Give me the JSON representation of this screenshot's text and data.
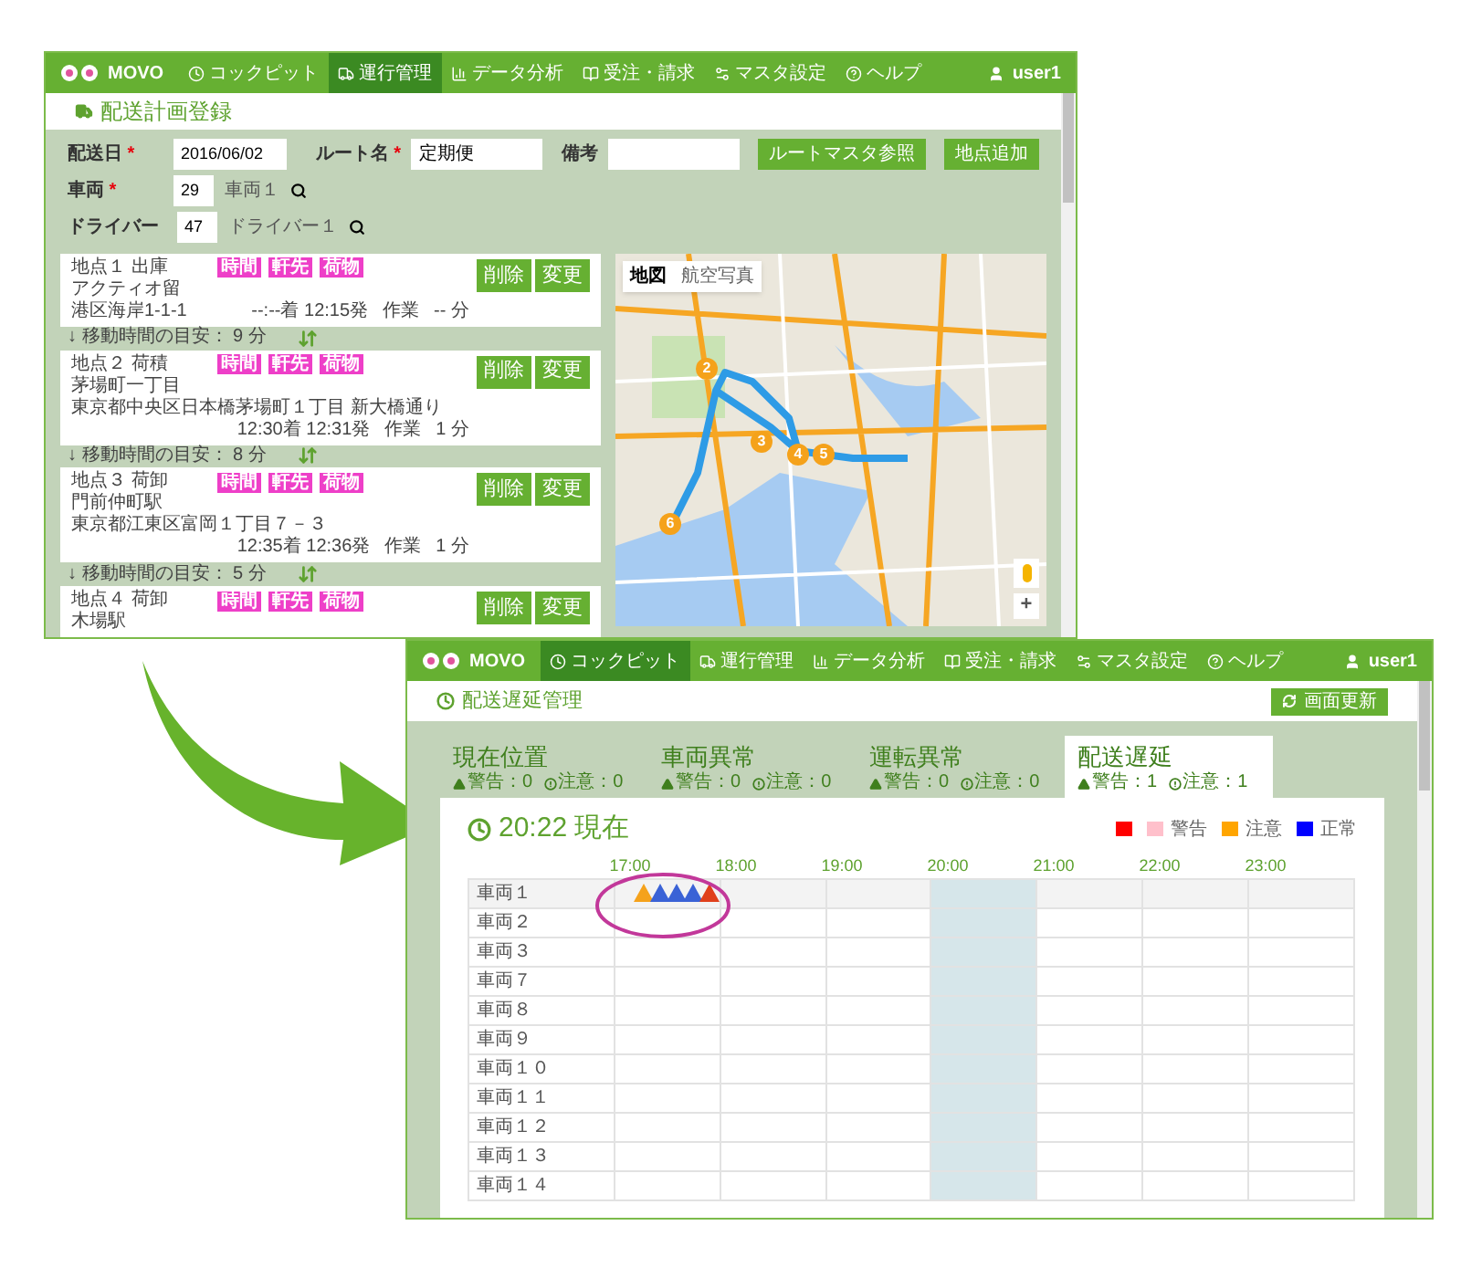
{
  "planning_window": {
    "nav": {
      "brand": "MOVO",
      "user": "user1",
      "items": [
        {
          "label": "コックピット",
          "selected": false
        },
        {
          "label": "運行管理",
          "selected": true
        },
        {
          "label": "データ分析",
          "selected": false
        },
        {
          "label": "受注・請求",
          "selected": false
        },
        {
          "label": "マスタ設定",
          "selected": false
        },
        {
          "label": "ヘルプ",
          "selected": false
        }
      ]
    },
    "page_title": "配送計画登録",
    "required_mark": "*",
    "form": {
      "date": {
        "label": "配送日",
        "required": true,
        "value": "2016/06/02"
      },
      "route": {
        "label": "ルート名",
        "required": true,
        "value": "定期便"
      },
      "note": {
        "label": "備考",
        "required": false
      },
      "buttons": [
        "ルートマスタ参照",
        "地点追加"
      ],
      "vehicle": {
        "label": "車両",
        "required": true,
        "value": "29",
        "name": "車両１"
      },
      "driver": {
        "label": "ドライバー",
        "required": false,
        "value": "47",
        "name": "ドライバー１"
      }
    },
    "stops": [
      {
        "title": "地点１ 出庫",
        "tags": [
          "時間",
          "軒先",
          "荷物"
        ],
        "name": "アクティオ留",
        "address": "港区海岸1-1-1",
        "times": "--:--着 12:15発",
        "work_label": "作業",
        "work": "-- 分",
        "actions": [
          "削除",
          "変更"
        ],
        "travel": "↓ 移動時間の目安： 9 分"
      },
      {
        "title": "地点２ 荷積",
        "tags": [
          "時間",
          "軒先",
          "荷物"
        ],
        "name": "茅場町一丁目",
        "address": "東京都中央区日本橋茅場町１丁目 新大橋通り",
        "times": "12:30着 12:31発",
        "work_label": "作業",
        "work": "1 分",
        "actions": [
          "削除",
          "変更"
        ],
        "travel": "↓ 移動時間の目安： 8 分"
      },
      {
        "title": "地点３ 荷卸",
        "tags": [
          "時間",
          "軒先",
          "荷物"
        ],
        "name": "門前仲町駅",
        "address": "東京都江東区富岡１丁目７－３",
        "times": "12:35着 12:36発",
        "work_label": "作業",
        "work": "1 分",
        "actions": [
          "削除",
          "変更"
        ],
        "travel": "↓ 移動時間の目安： 5 分"
      },
      {
        "title": "地点４ 荷卸",
        "tags": [
          "時間",
          "軒先",
          "荷物"
        ],
        "name": "木場駅",
        "actions": [
          "削除",
          "変更"
        ]
      }
    ],
    "map": {
      "types": [
        {
          "label": "地図",
          "selected": true
        },
        {
          "label": "航空写真",
          "selected": false
        }
      ],
      "markers": [
        {
          "label": "2"
        },
        {
          "label": "3"
        },
        {
          "label": "4"
        },
        {
          "label": "5"
        },
        {
          "label": "6"
        }
      ],
      "zoom_in": "+"
    }
  },
  "delay_window": {
    "nav": {
      "brand": "MOVO",
      "user": "user1",
      "items": [
        {
          "label": "コックピット",
          "selected": true
        },
        {
          "label": "運行管理",
          "selected": false
        },
        {
          "label": "データ分析",
          "selected": false
        },
        {
          "label": "受注・請求",
          "selected": false
        },
        {
          "label": "マスタ設定",
          "selected": false
        },
        {
          "label": "ヘルプ",
          "selected": false
        }
      ]
    },
    "page_title": "配送遅延管理",
    "refresh_button": "画面更新",
    "tabs": [
      {
        "title": "現在位置",
        "warning": "警告：0",
        "caution": "注意：0",
        "selected": false
      },
      {
        "title": "車両異常",
        "warning": "警告：0",
        "caution": "注意：0",
        "selected": false
      },
      {
        "title": "運転異常",
        "warning": "警告：0",
        "caution": "注意：0",
        "selected": false
      },
      {
        "title": "配送遅延",
        "warning": "警告：1",
        "caution": "注意：1",
        "selected": true
      }
    ],
    "current_time": "20:22 現在",
    "legend": [
      {
        "color": "#ff0000"
      },
      {
        "color": "#ffc0cb",
        "label": "警告"
      },
      {
        "color": "#ffa500",
        "label": "注意"
      },
      {
        "color": "#0000ff",
        "label": "正常"
      }
    ],
    "hours": [
      {
        "label": "17:00",
        "current": false
      },
      {
        "label": "18:00",
        "current": false
      },
      {
        "label": "19:00",
        "current": false
      },
      {
        "label": "20:00",
        "current": true
      },
      {
        "label": "21:00",
        "current": false
      },
      {
        "label": "22:00",
        "current": false
      },
      {
        "label": "23:00",
        "current": false
      }
    ],
    "rows": [
      {
        "label": "車両１",
        "highlighted": true,
        "events": [
          {
            "color": "#f5a21b"
          },
          {
            "color": "#3a62d6"
          },
          {
            "color": "#3a62d6"
          },
          {
            "color": "#3a62d6"
          },
          {
            "color": "#e0401c"
          }
        ]
      },
      {
        "label": "車両２",
        "highlighted": false
      },
      {
        "label": "車両３",
        "highlighted": false
      },
      {
        "label": "車両７",
        "highlighted": false
      },
      {
        "label": "車両８",
        "highlighted": false
      },
      {
        "label": "車両９",
        "highlighted": false
      },
      {
        "label": "車両１０",
        "highlighted": false
      },
      {
        "label": "車両１１",
        "highlighted": false
      },
      {
        "label": "車両１２",
        "highlighted": false
      },
      {
        "label": "車両１３",
        "highlighted": false
      },
      {
        "label": "車両１４",
        "highlighted": false
      }
    ]
  }
}
